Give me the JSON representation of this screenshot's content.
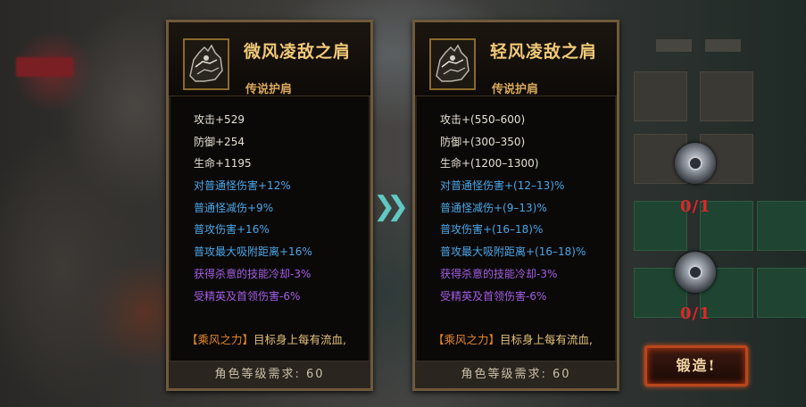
{
  "left_card": {
    "name": "微风凌敌之肩",
    "type": "传说护肩",
    "stats": [
      {
        "text": "攻击+529",
        "color": "white"
      },
      {
        "text": "防御+254",
        "color": "white"
      },
      {
        "text": "生命+1195",
        "color": "white"
      },
      {
        "text": "对普通怪伤害+12%",
        "color": "blue"
      },
      {
        "text": "普通怪减伤+9%",
        "color": "blue"
      },
      {
        "text": "普攻伤害+16%",
        "color": "blue"
      },
      {
        "text": "普攻最大吸附距离+16%",
        "color": "blue"
      },
      {
        "text": "获得杀意的技能冷却-3%",
        "color": "purple"
      },
      {
        "text": "受精英及首领伤害-6%",
        "color": "purple"
      }
    ],
    "passive_name": "【乘风之力】",
    "passive_text": "目标身上每有流血,",
    "requirement": "角色等级需求: 60"
  },
  "right_card": {
    "name": "轻风凌敌之肩",
    "type": "传说护肩",
    "stats": [
      {
        "text": "攻击+(550–600)",
        "color": "white"
      },
      {
        "text": "防御+(300–350)",
        "color": "white"
      },
      {
        "text": "生命+(1200–1300)",
        "color": "white"
      },
      {
        "text": "对普通怪伤害+(12–13)%",
        "color": "blue"
      },
      {
        "text": "普通怪减伤+(9–13)%",
        "color": "blue"
      },
      {
        "text": "普攻伤害+(16–18)%",
        "color": "blue"
      },
      {
        "text": "普攻最大吸附距离+(16–18)%",
        "color": "blue"
      },
      {
        "text": "获得杀意的技能冷却-3%",
        "color": "purple"
      },
      {
        "text": "受精英及首领伤害-6%",
        "color": "purple"
      }
    ],
    "passive_name": "【乘风之力】",
    "passive_text": "目标身上每有流血,",
    "requirement": "角色等级需求: 60"
  },
  "materials": [
    {
      "icon": "gear-material-icon",
      "count": "0/1"
    },
    {
      "icon": "core-material-icon",
      "count": "0/1"
    }
  ],
  "forge_button": "锻造!",
  "colors": {
    "name": "#f0c978",
    "stat_white": "#e6e0d2",
    "stat_blue": "#4aa6e8",
    "stat_purple": "#a35de6",
    "count_red": "#e0252a",
    "forge_border": "#b8461c"
  }
}
